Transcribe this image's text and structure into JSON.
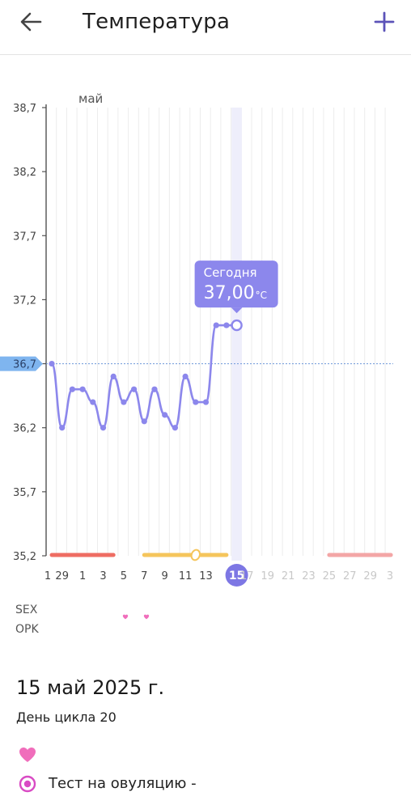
{
  "header": {
    "title": "Температура",
    "back_icon": "arrow-left-icon",
    "add_icon": "plus-icon",
    "accent": "#5b52b8"
  },
  "chart_data": {
    "type": "line",
    "month_label": "май",
    "y_ticks": [
      "38,7",
      "38,2",
      "37,7",
      "37,2",
      "36,7",
      "36,2",
      "35,7",
      "35,2"
    ],
    "ylim": [
      35.2,
      38.7
    ],
    "reference_value": 36.7,
    "reference_label": "36,7",
    "x_tick_labels": [
      "1",
      "29",
      "1",
      "3",
      "5",
      "7",
      "9",
      "11",
      "13",
      "15",
      "17",
      "19",
      "21",
      "23",
      "25",
      "27",
      "29",
      "3"
    ],
    "points_day_index": [
      0,
      1,
      2,
      3,
      4,
      5,
      6,
      7,
      8,
      9,
      10,
      11,
      12,
      13,
      14,
      15,
      16,
      17,
      18
    ],
    "values": [
      36.7,
      36.2,
      36.5,
      36.5,
      36.4,
      36.2,
      36.6,
      36.4,
      36.5,
      36.25,
      36.5,
      36.3,
      36.2,
      36.6,
      36.4,
      36.4,
      37.0,
      37.0,
      37.0
    ],
    "today_index": 18,
    "today_label": "15",
    "tooltip": {
      "title": "Сегодня",
      "value": "37,00",
      "unit": "°C"
    },
    "period_bar": {
      "color": "#ee6d63",
      "from_day": 0,
      "to_day": 6
    },
    "fertile_bar": {
      "color": "#f5c55c",
      "from_day": 9,
      "to_day": 17,
      "ovulation_day": 14
    },
    "next_period_bar": {
      "color": "#f3a6a6",
      "from_day": 27,
      "to_day": 33
    },
    "line_color": "#8c87ec",
    "grid": true
  },
  "rows": {
    "sex_label": "SEX",
    "opk_label": "OPK",
    "sex_heart_days": [
      6,
      8
    ]
  },
  "detail": {
    "date": "15 май 2025 г.",
    "cycle_day": "День цикла 20",
    "heart_icon": "heart-icon",
    "ovulation_icon": "ovulation-test-icon",
    "ovulation_text": "Тест на овуляцию -"
  }
}
